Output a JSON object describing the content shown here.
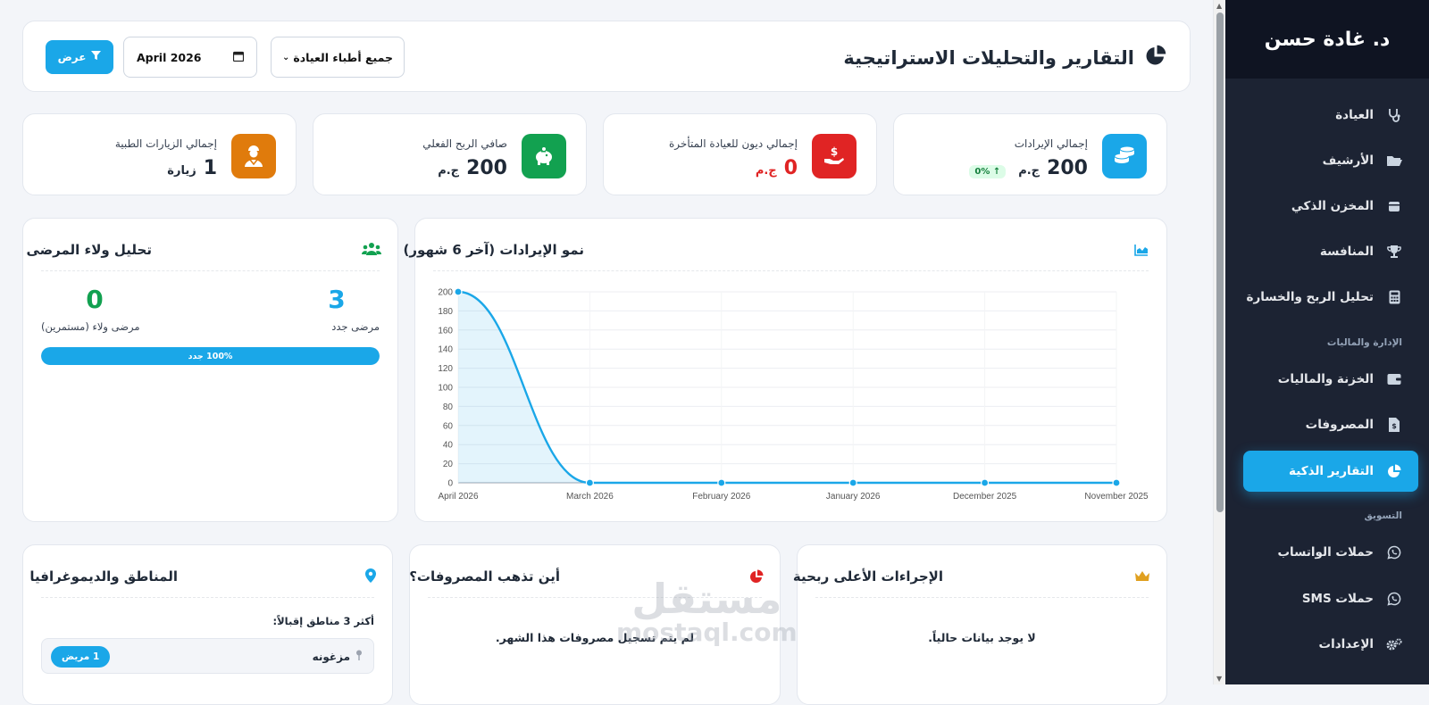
{
  "sidebar": {
    "user_name": "د. غادة حسن",
    "items": [
      {
        "label": "العيادة",
        "icon": "stethoscope-icon"
      },
      {
        "label": "الأرشيف",
        "icon": "folder-open-icon"
      },
      {
        "label": "المخزن الذكي",
        "icon": "box-icon"
      },
      {
        "label": "المنافسة",
        "icon": "trophy-icon"
      },
      {
        "label": "تحليل الربح والخسارة",
        "icon": "calculator-icon"
      },
      {
        "label": "الخزنة والماليات",
        "icon": "wallet-icon"
      },
      {
        "label": "المصروفات",
        "icon": "invoice-icon"
      },
      {
        "label": "التقارير الذكية",
        "icon": "pie-chart-icon"
      },
      {
        "label": "حملات الواتساب",
        "icon": "whatsapp-icon"
      },
      {
        "label": "حملات SMS",
        "icon": "whatsapp-icon"
      },
      {
        "label": "الإعدادات",
        "icon": "gears-icon"
      }
    ],
    "sections": {
      "management": "الإدارة والماليات",
      "marketing": "التسويق"
    }
  },
  "header": {
    "title": "التقارير والتحليلات الاستراتيجية",
    "doctor_filter": "جميع أطباء العيادة",
    "month_value": "April 2026",
    "view_button": "عرض"
  },
  "kpis": [
    {
      "label": "إجمالي الإيرادات",
      "value": "200",
      "unit": "ج.م",
      "badge": "0%",
      "color": "#1aa7e8",
      "icon": "coins-icon"
    },
    {
      "label": "إجمالي ديون للعيادة المتأخرة",
      "value": "0",
      "unit": "ج.م",
      "color": "#e02424",
      "icon": "hand-dollar-icon"
    },
    {
      "label": "صافي الربح الفعلي",
      "value": "200",
      "unit": "ج.م",
      "color": "#12a150",
      "icon": "piggy-bank-icon"
    },
    {
      "label": "إجمالي الزيارات الطبية",
      "value": "1",
      "unit": "زيارة",
      "color": "#e07b0c",
      "icon": "doctor-icon"
    }
  ],
  "revenue_chart": {
    "title": "نمو الإيرادات (آخر 6 شهور)",
    "color": "#1aa7e8"
  },
  "chart_data": {
    "type": "area",
    "categories": [
      "April 2026",
      "March 2026",
      "February 2026",
      "January 2026",
      "December 2025",
      "November 2025"
    ],
    "values": [
      200,
      0,
      0,
      0,
      0,
      0
    ],
    "ylim": [
      0,
      200
    ],
    "yticks": [
      0,
      20,
      40,
      60,
      80,
      100,
      120,
      140,
      160,
      180,
      200
    ],
    "grid": true,
    "legend": "none"
  },
  "loyalty": {
    "title": "تحليل ولاء المرضى",
    "new_count": "3",
    "new_label": "مرضى جدد",
    "loyal_count": "0",
    "loyal_label": "مرضى ولاء (مستمرين)",
    "bar_text": "100% جدد",
    "bar_fraction": 1.0
  },
  "bottom": {
    "procedures": {
      "title": "الإجراءات الأعلى ربحية",
      "empty": "لا يوجد بيانات حالياً."
    },
    "expenses": {
      "title": "أين تذهب المصروفات؟",
      "empty": "لم يتم تسجيل مصروفات هذا الشهر."
    },
    "regions": {
      "title": "المناطق والديموغرافيا",
      "subtitle": "أكثر 3 مناطق إقبالاً:",
      "items": [
        {
          "name": "مزغونه",
          "count": "1 مريض"
        }
      ]
    }
  },
  "watermark": {
    "line1": "مستقل",
    "line2": "mostaql.com"
  }
}
